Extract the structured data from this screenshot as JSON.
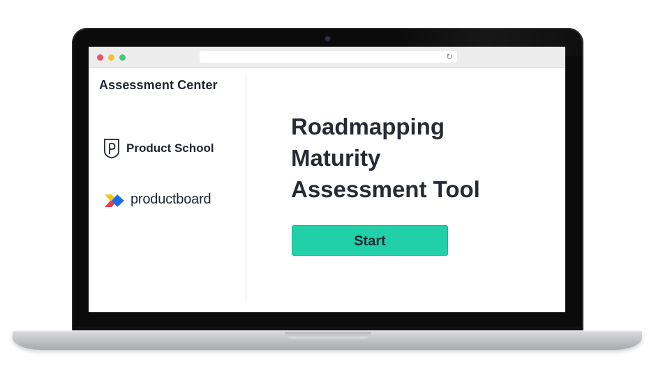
{
  "browser": {
    "reload_icon": "reload-icon",
    "reload_glyph": "↻"
  },
  "sidebar": {
    "title": "Assessment Center",
    "logos": [
      {
        "name": "Product School",
        "icon": "product-school-shield-icon"
      },
      {
        "name": "productboard",
        "icon": "productboard-icon"
      }
    ]
  },
  "main": {
    "headline": [
      "Roadmapping",
      "Maturity",
      "Assessment Tool"
    ],
    "start_label": "Start"
  },
  "colors": {
    "accent": "#21d0a8",
    "text": "#262b33",
    "traffic_red": "#ef4f6b",
    "traffic_yellow": "#f4bf3a",
    "traffic_green": "#41c979"
  }
}
